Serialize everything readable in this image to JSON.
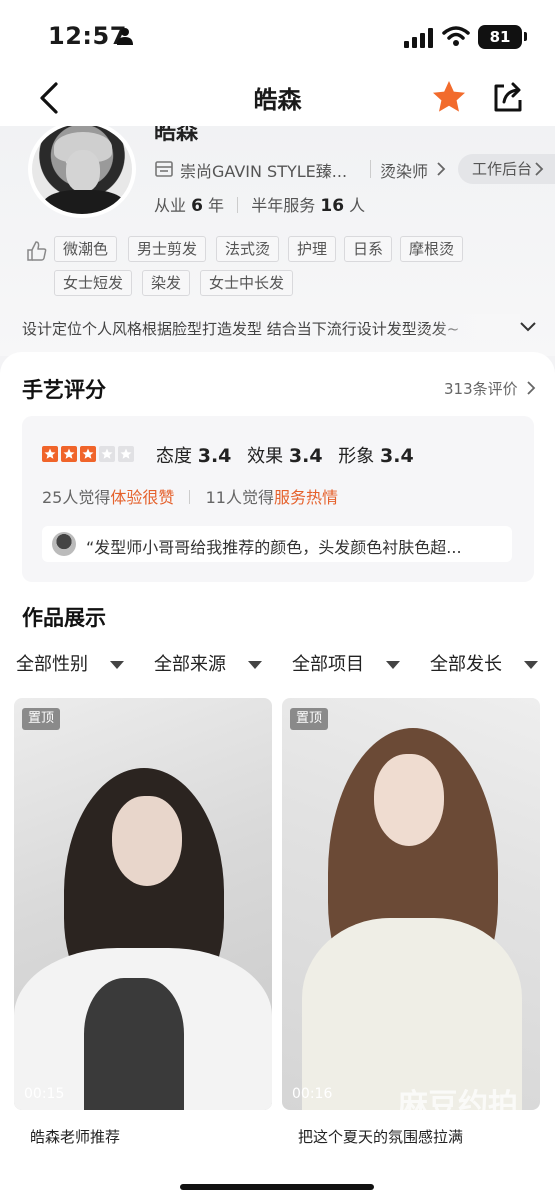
{
  "status_bar": {
    "time": "12:57",
    "battery": "81",
    "icons": [
      "person-icon",
      "signal-icon",
      "wifi-icon",
      "battery-icon"
    ]
  },
  "nav": {
    "title": "皓森",
    "icons": [
      "back-icon",
      "star-icon",
      "share-icon"
    ],
    "star_color": "#f26b2c"
  },
  "profile": {
    "name": "皓森",
    "shop_name": "崇尚GAVIN STYLE臻...",
    "job_title": "烫染师",
    "workbench_label": "工作后台",
    "years_prefix": "从业",
    "years_value": "6",
    "years_unit": "年",
    "served_prefix": "半年服务",
    "served_value": "16",
    "served_unit": "人",
    "tags": [
      "微潮色",
      "男士剪发",
      "法式烫",
      "护理",
      "日系",
      "摩根烫",
      "女士短发",
      "染发",
      "女士中长发"
    ],
    "bio": "设计定位个人风格根据脸型打造发型 结合当下流行设计发型烫发~"
  },
  "rating": {
    "section_title": "手艺评分",
    "review_count": "313条评价",
    "stars_filled": 3,
    "stars_total": 5,
    "star_color": "#f0642a",
    "attitude_label": "态度",
    "attitude_value": "3.4",
    "effect_label": "效果",
    "effect_value": "3.4",
    "image_label": "形象",
    "image_value": "3.4",
    "praise1_prefix": "25人觉得",
    "praise1_highlight": "体验很赞",
    "praise2_prefix": "11人觉得",
    "praise2_highlight": "服务热情",
    "highlight_color": "#e5612c",
    "quote": "“发型师小哥哥给我推荐的颜色，头发颜色衬肤色超..."
  },
  "works": {
    "section_title": "作品展示",
    "filters": [
      "全部性别",
      "全部来源",
      "全部项目",
      "全部发长"
    ],
    "items": [
      {
        "badge": "置顶",
        "duration": "00:15",
        "caption": "皓森老师推荐"
      },
      {
        "badge": "置顶",
        "duration": "00:16",
        "caption": "把这个夏天的氛围感拉满"
      }
    ],
    "watermark": "麻豆约拍"
  }
}
